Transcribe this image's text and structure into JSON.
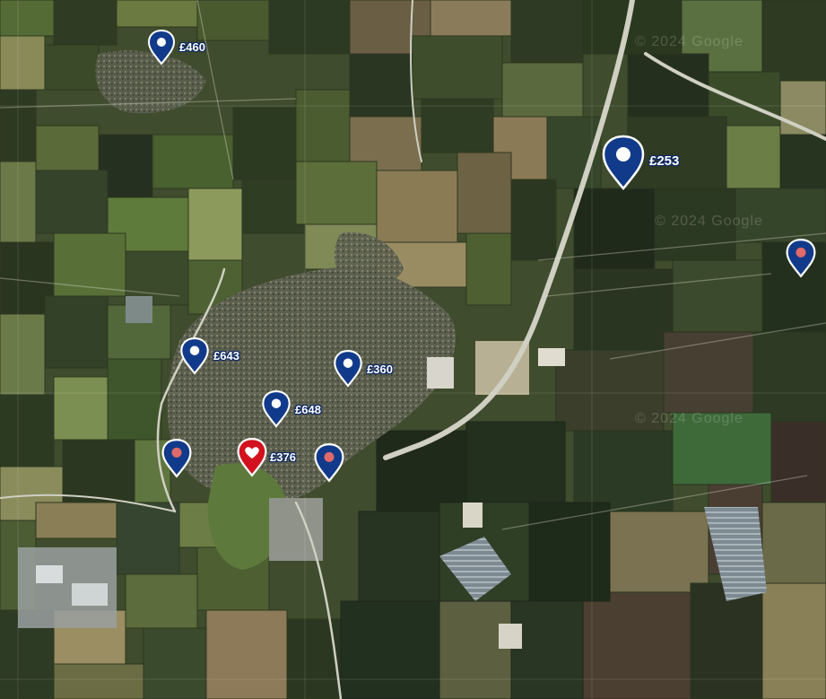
{
  "map": {
    "colors": {
      "pin_fill": "#123a8a",
      "pin_outline": "#ffffff",
      "favourite_fill": "#d1121e",
      "dot_viewed": "#e06a6a",
      "dot_default": "#ffffff"
    },
    "watermarks": [
      "© 2024 Google",
      "© 2024 Google",
      "© 2024 Google"
    ],
    "markers": [
      {
        "id": "460",
        "price": "£460",
        "kind": "property-pin",
        "dot": "white"
      },
      {
        "id": "253",
        "price": "£253",
        "kind": "property-pin-selected",
        "dot": "white"
      },
      {
        "id": "ne",
        "price": "",
        "kind": "property-pin",
        "dot": "viewed"
      },
      {
        "id": "643",
        "price": "£643",
        "kind": "property-pin",
        "dot": "white"
      },
      {
        "id": "360",
        "price": "£360",
        "kind": "property-pin",
        "dot": "white"
      },
      {
        "id": "648",
        "price": "£648",
        "kind": "property-pin",
        "dot": "white"
      },
      {
        "id": "w",
        "price": "",
        "kind": "property-pin",
        "dot": "viewed"
      },
      {
        "id": "376",
        "price": "£376",
        "kind": "favourite-pin",
        "dot": "heart"
      },
      {
        "id": "s",
        "price": "",
        "kind": "property-pin",
        "dot": "viewed"
      }
    ]
  }
}
